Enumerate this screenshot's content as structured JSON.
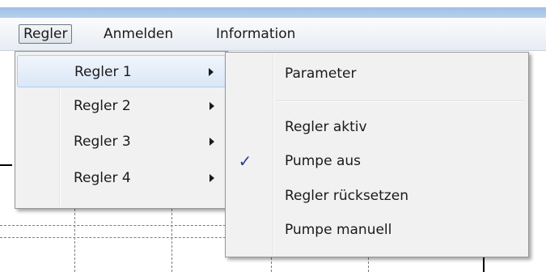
{
  "menubar": {
    "items": [
      {
        "label": "Regler"
      },
      {
        "label": "Anmelden"
      },
      {
        "label": "Information"
      }
    ]
  },
  "regler_menu": {
    "items": [
      {
        "label": "Regler 1"
      },
      {
        "label": "Regler 2"
      },
      {
        "label": "Regler 3"
      },
      {
        "label": "Regler 4"
      }
    ]
  },
  "submenu": {
    "items": [
      {
        "label": "Parameter"
      },
      {
        "label": "Regler aktiv"
      },
      {
        "label": "Pumpe aus",
        "checked": true
      },
      {
        "label": "Regler rücksetzen"
      },
      {
        "label": "Pumpe manuell"
      }
    ],
    "check_glyph": "✓"
  }
}
